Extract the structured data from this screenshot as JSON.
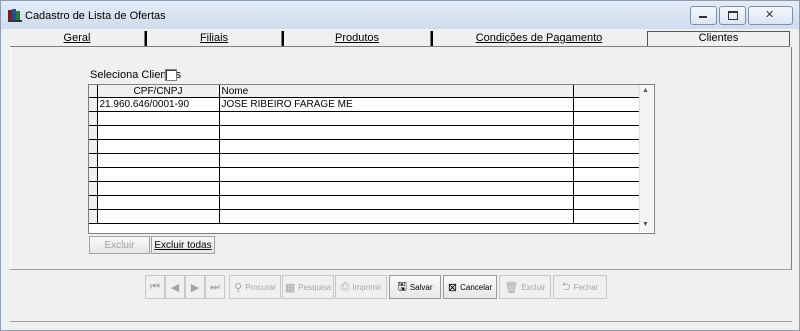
{
  "window": {
    "title": "Cadastro de Lista de Ofertas"
  },
  "tabs": [
    {
      "label": "Geral"
    },
    {
      "label": "Filiais"
    },
    {
      "label": "Produtos"
    },
    {
      "label": "Condições de Pagamento"
    },
    {
      "label": "Clientes"
    }
  ],
  "active_tab": "Clientes",
  "selection": {
    "label": "Seleciona Clientes",
    "checked": false
  },
  "grid": {
    "columns": [
      "CPF/CNPJ",
      "Nome",
      ""
    ],
    "rows": [
      [
        "21.960.646/0001-90",
        "JOSE RIBEIRO FARAGE ME",
        ""
      ],
      [
        "",
        "",
        ""
      ],
      [
        "",
        "",
        ""
      ],
      [
        "",
        "",
        ""
      ],
      [
        "",
        "",
        ""
      ],
      [
        "",
        "",
        ""
      ],
      [
        "",
        "",
        ""
      ],
      [
        "",
        "",
        ""
      ],
      [
        "",
        "",
        ""
      ]
    ]
  },
  "buttons": {
    "excluir": "Excluir",
    "excluir_todas": "Excluir todas"
  },
  "toolbar": {
    "procurar": "Procurar",
    "pesquisa": "Pesquisa",
    "imprimir": "Imprimir",
    "salvar": "Salvar",
    "cancelar": "Cancelar",
    "excluir": "Excluir",
    "fechar": "Fechar"
  }
}
